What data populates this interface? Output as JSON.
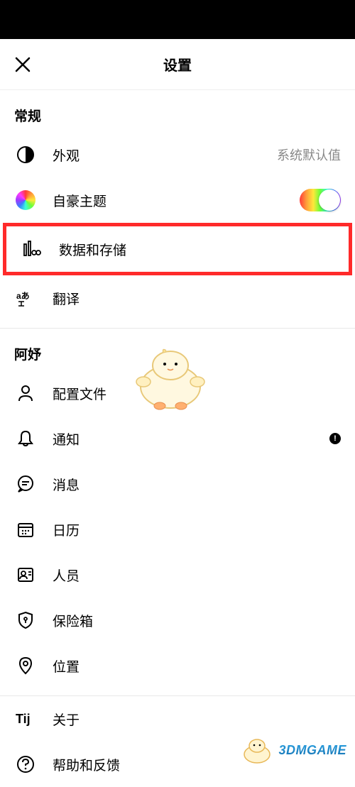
{
  "header": {
    "title": "设置"
  },
  "sections": {
    "general": {
      "title": "常规",
      "appearance": {
        "label": "外观",
        "value": "系统默认值"
      },
      "pride_theme": {
        "label": "自豪主题"
      },
      "data_storage": {
        "label": "数据和存储"
      },
      "translate": {
        "label": "翻译"
      }
    },
    "account": {
      "title": "阿妤",
      "profile": {
        "label": "配置文件"
      },
      "notifications": {
        "label": "通知"
      },
      "messages": {
        "label": "消息"
      },
      "calendar": {
        "label": "日历"
      },
      "people": {
        "label": "人员"
      },
      "vault": {
        "label": "保险箱"
      },
      "location": {
        "label": "位置"
      }
    },
    "footer": {
      "about": {
        "label": "关于"
      },
      "help": {
        "label": "帮助和反馈"
      }
    }
  },
  "watermark": "3DMGAME"
}
